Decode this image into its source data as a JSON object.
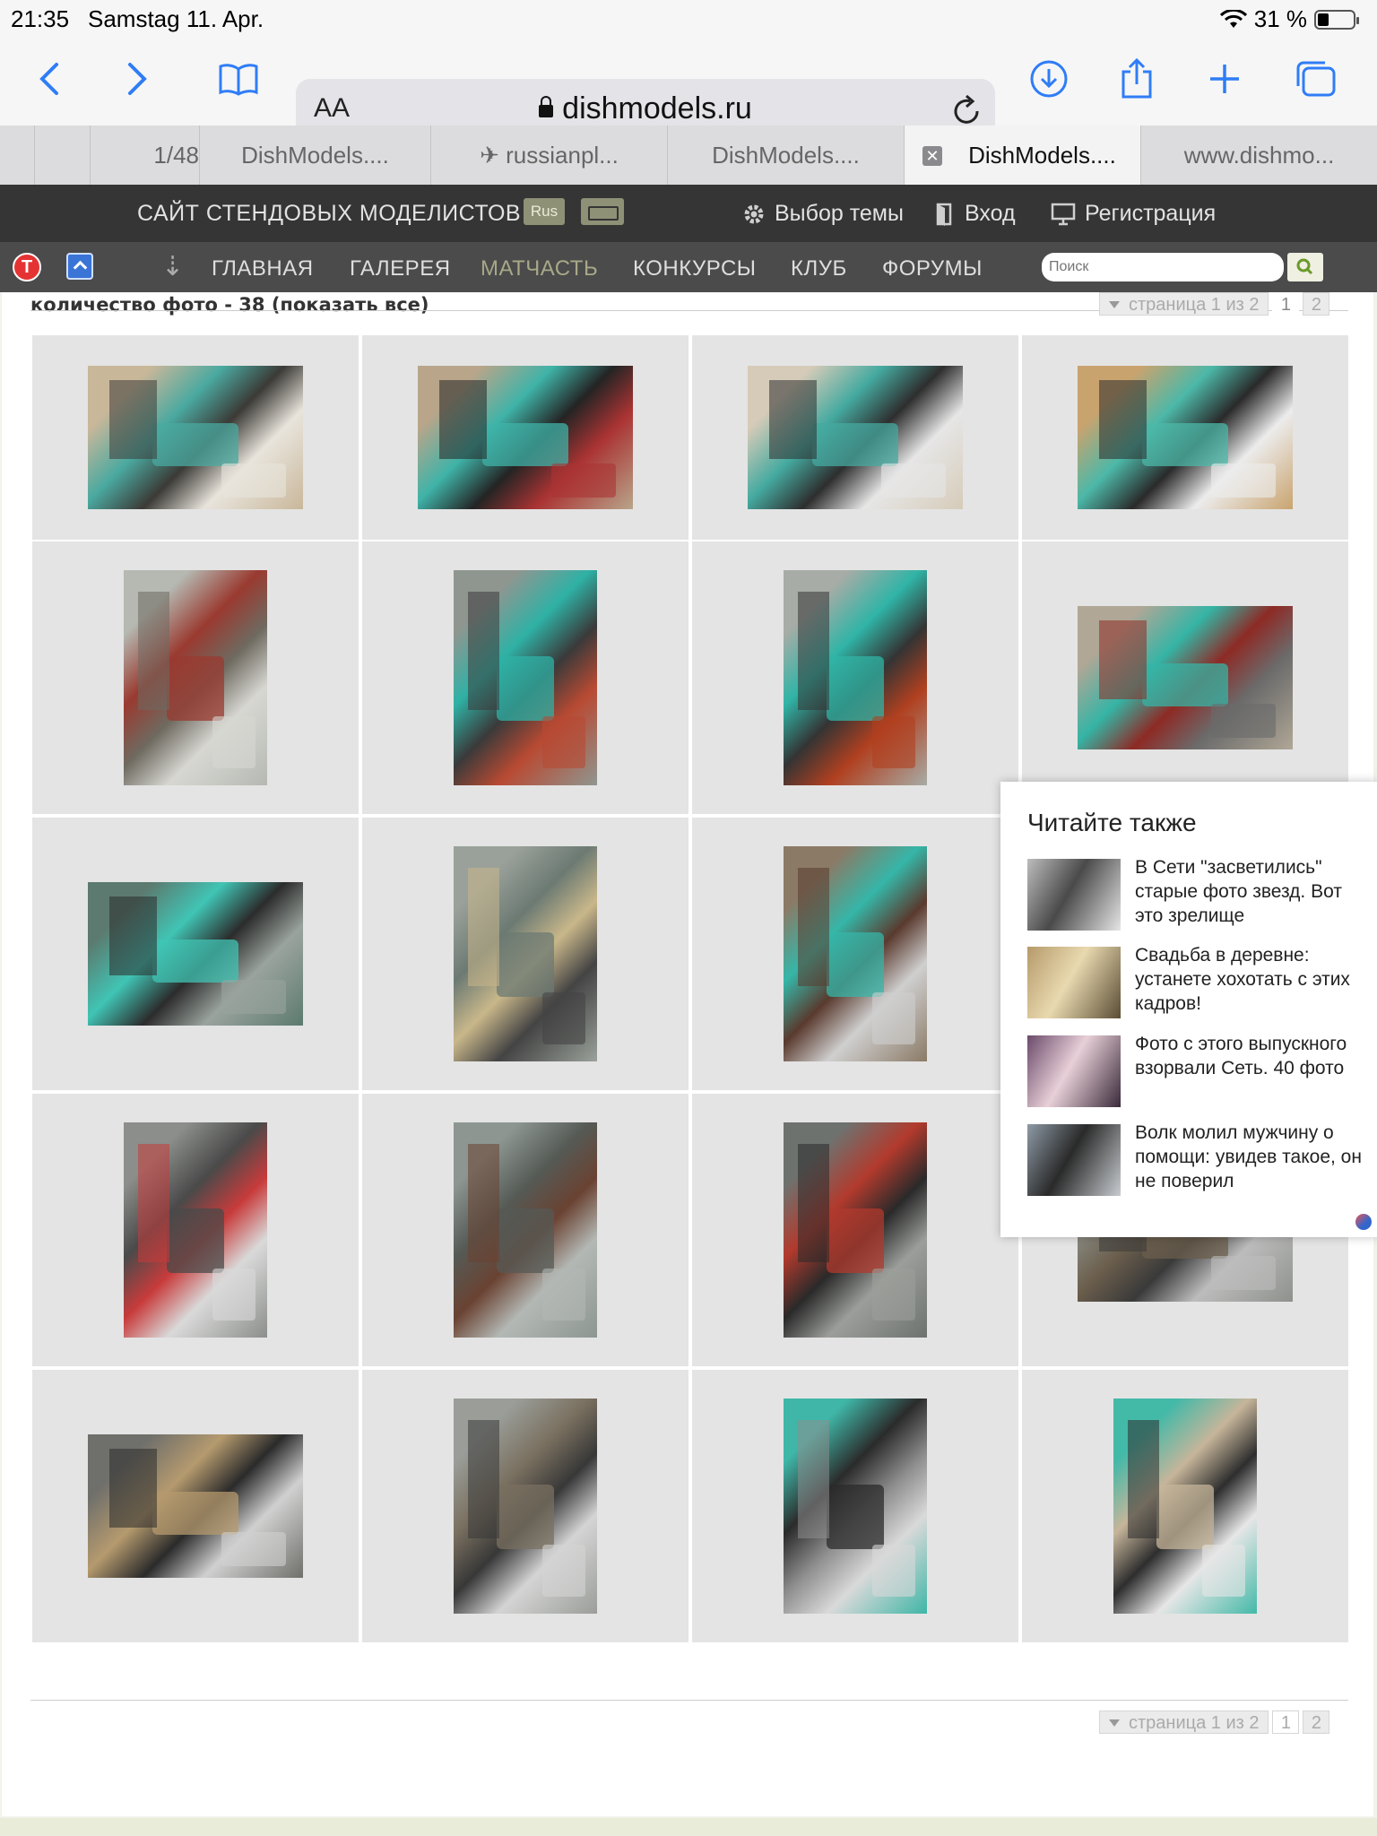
{
  "status": {
    "time": "21:35",
    "date": "Samstag 11. Apr.",
    "battery": "31 %",
    "battery_level": 0.31
  },
  "browser": {
    "aa": "AA",
    "url": "dishmodels.ru",
    "tabs": [
      {
        "label": ""
      },
      {
        "label": "1/48"
      },
      {
        "label": "DishModels...."
      },
      {
        "label": "✈ russianpl..."
      },
      {
        "label": "DishModels...."
      },
      {
        "label": "DishModels...."
      },
      {
        "label": "www.dishmo..."
      }
    ]
  },
  "site": {
    "title": "САЙТ СТЕНДОВЫХ МОДЕЛИСТОВ",
    "lang": "Rus",
    "theme": "Выбор темы",
    "login": "Вход",
    "register": "Регистрация"
  },
  "nav": {
    "t_badge": "T",
    "items": [
      "ГЛАВНАЯ",
      "ГАЛЕРЕЯ",
      "МАТЧАСТЬ",
      "КОНКУРСЫ",
      "КЛУБ",
      "ФОРУМЫ"
    ],
    "search_placeholder": "Поиск"
  },
  "gallery": {
    "count_label": "количество фото - 38",
    "show_all": "(показать все)",
    "pager": {
      "info": "страница 1 из 2",
      "pages": [
        "1",
        "2"
      ]
    },
    "photos": [
      {
        "orient": "land",
        "palette": [
          "#c9b79a",
          "#4aa9a0",
          "#3c3a36",
          "#e8e4dc"
        ]
      },
      {
        "orient": "land",
        "palette": [
          "#b8a58a",
          "#3fb3a8",
          "#242424",
          "#a33"
        ]
      },
      {
        "orient": "land",
        "palette": [
          "#d6cbb8",
          "#45aaa0",
          "#2e2e2e",
          "#e6e6e6"
        ]
      },
      {
        "orient": "land",
        "palette": [
          "#c9a36e",
          "#4cb8a8",
          "#2a2a2a",
          "#ececec"
        ]
      },
      {
        "orient": "port",
        "palette": [
          "#b5b9b2",
          "#9a3a30",
          "#6e6a60",
          "#d7d7d2"
        ]
      },
      {
        "orient": "port",
        "palette": [
          "#8f9690",
          "#2fb1a5",
          "#3a3a3a",
          "#b84a33"
        ]
      },
      {
        "orient": "port",
        "palette": [
          "#a7aca6",
          "#30b4a6",
          "#343434",
          "#b04020"
        ]
      },
      {
        "orient": "land",
        "palette": [
          "#b0a796",
          "#35b4a5",
          "#8e2a25",
          "#6b6b6b"
        ]
      },
      {
        "orient": "land",
        "palette": [
          "#5c7a6f",
          "#40c4b4",
          "#2c2c2c",
          "#9aa39e"
        ]
      },
      {
        "orient": "port",
        "palette": [
          "#9aa19a",
          "#6c7a73",
          "#c9b78a",
          "#444"
        ]
      },
      {
        "orient": "port",
        "palette": [
          "#8b7a66",
          "#35b6a8",
          "#5a3a2e",
          "#cfcfcf"
        ]
      },
      {
        "orient": "port",
        "palette": [
          "#8b8e8a",
          "#4a4a4a",
          "#c83b3b",
          "#d9d9d9"
        ]
      },
      {
        "orient": "port",
        "palette": [
          "#8d9691",
          "#555a55",
          "#6a4232",
          "#b3b8b4"
        ]
      },
      {
        "orient": "port",
        "palette": [
          "#6e726f",
          "#b23a2d",
          "#2a2a2a",
          "#9b9e9a"
        ]
      },
      {
        "orient": "land",
        "palette": [
          "#8e918c",
          "#6b5e4c",
          "#3a3a3a",
          "#bcbcbc"
        ]
      },
      {
        "orient": "land",
        "palette": [
          "#6f6f6b",
          "#b59a6e",
          "#2b2b2b",
          "#d0d0d0"
        ]
      },
      {
        "orient": "port",
        "palette": [
          "#9a9d98",
          "#7a7060",
          "#383838",
          "#d4d4d4"
        ]
      },
      {
        "orient": "port",
        "palette": [
          "#3fb6a7",
          "#2b2b2b",
          "#8e8e8e",
          "#d9d9d9"
        ]
      },
      {
        "orient": "port",
        "palette": [
          "#43b9a8",
          "#c6b59a",
          "#2e2e2e",
          "#e6e6e6"
        ]
      }
    ]
  },
  "read_also": {
    "title": "Читайте также",
    "items": [
      {
        "text": "В Сети \"засветились\" старые фото звезд. Вот это зрелище",
        "palette": [
          "#bdbdbd",
          "#4a4a4a",
          "#e6e6e6"
        ]
      },
      {
        "text": "Свадьба в деревне: устанете хохотать с этих кадров!",
        "palette": [
          "#b59a6a",
          "#e9d9b0",
          "#5a4c34"
        ]
      },
      {
        "text": "Фото с этого выпускного взорвали Сеть. 40 фото",
        "palette": [
          "#6a4a6a",
          "#e8d0d8",
          "#3a2a3a"
        ]
      },
      {
        "text": "Волк молил мужчину о помощи: увидев такое, он не поверил",
        "palette": [
          "#8e9aa6",
          "#2a2a2a",
          "#c8ccd0"
        ]
      }
    ]
  }
}
